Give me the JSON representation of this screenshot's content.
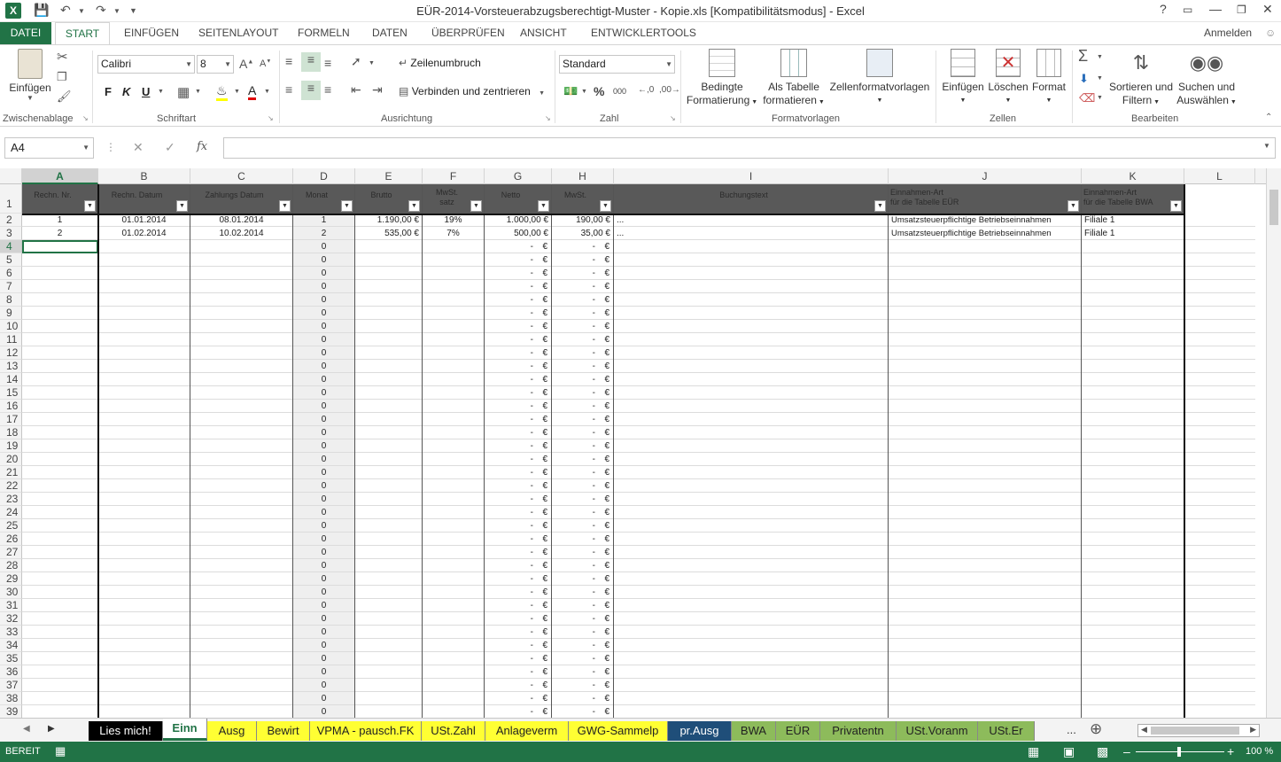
{
  "window": {
    "title": "EÜR-2014-Vorsteuerabzugsberechtigt-Muster - Kopie.xls  [Kompatibilitätsmodus] - Excel",
    "help": "?",
    "signin": "Anmelden"
  },
  "ribbon_tabs": [
    "DATEI",
    "START",
    "EINFÜGEN",
    "SEITENLAYOUT",
    "FORMELN",
    "DATEN",
    "ÜBERPRÜFEN",
    "ANSICHT",
    "ENTWICKLERTOOLS"
  ],
  "ribbon": {
    "clipboard": {
      "paste": "Einfügen",
      "label": "Zwischenablage"
    },
    "font": {
      "name": "Calibri",
      "size": "8",
      "bold": "F",
      "italic": "K",
      "underline": "U",
      "label": "Schriftart"
    },
    "alignment": {
      "wrap": "Zeilenumbruch",
      "merge": "Verbinden und zentrieren",
      "label": "Ausrichtung"
    },
    "number": {
      "format": "Standard",
      "percent": "%",
      "thousands": "000",
      "label": "Zahl"
    },
    "styles": {
      "conditional_1": "Bedingte",
      "conditional_2": "Formatierung",
      "table_1": "Als Tabelle",
      "table_2": "formatieren",
      "cellstyles": "Zellenformatvorlagen",
      "label": "Formatvorlagen"
    },
    "cells": {
      "insert": "Einfügen",
      "delete": "Löschen",
      "format": "Format",
      "label": "Zellen"
    },
    "editing": {
      "sort_1": "Sortieren und",
      "sort_2": "Filtern",
      "find_1": "Suchen und",
      "find_2": "Auswählen",
      "label": "Bearbeiten"
    }
  },
  "formula_bar": {
    "name_box": "A4",
    "fx": "fx",
    "value": ""
  },
  "columns": [
    "A",
    "B",
    "C",
    "D",
    "E",
    "F",
    "G",
    "H",
    "I",
    "J",
    "K",
    "L"
  ],
  "header_cells": [
    {
      "lines": [
        "Rechn. Nr."
      ]
    },
    {
      "lines": [
        "Rechn. Datum"
      ]
    },
    {
      "lines": [
        "Zahlungs Datum"
      ]
    },
    {
      "lines": [
        "Monat"
      ]
    },
    {
      "lines": [
        "Brutto"
      ]
    },
    {
      "lines": [
        "MwSt.",
        "satz"
      ]
    },
    {
      "lines": [
        "Netto"
      ]
    },
    {
      "lines": [
        "MwSt."
      ]
    },
    {
      "lines": [
        "Buchungstext"
      ]
    },
    {
      "lines": [
        "Einnahmen-Art",
        "für die Tabelle EÜR"
      ]
    },
    {
      "lines": [
        "Einnahmen-Art",
        "für die Tabelle BWA"
      ]
    }
  ],
  "data_rows": [
    {
      "row": "2",
      "a": "1",
      "b": "01.01.2014",
      "c": "08.01.2014",
      "d": "1",
      "e": "1.190,00 €",
      "f": "19%",
      "g": "1.000,00 €",
      "h": "190,00 €",
      "i": "...",
      "j": "Umsatzsteuerpflichtige Betriebseinnahmen",
      "k": "Filiale 1"
    },
    {
      "row": "3",
      "a": "2",
      "b": "01.02.2014",
      "c": "10.02.2014",
      "d": "2",
      "e": "535,00 €",
      "f": "7%",
      "g": "500,00 €",
      "h": "35,00 €",
      "i": "...",
      "j": "Umsatzsteuerpflichtige Betriebseinnahmen",
      "k": "Filiale 1"
    }
  ],
  "empty_row_values": {
    "d": "0",
    "g": "-",
    "currency": "€",
    "h": "-"
  },
  "row_numbers": [
    "1",
    "2",
    "3",
    "4",
    "5",
    "6",
    "7",
    "8",
    "9",
    "10",
    "11",
    "12",
    "13",
    "14",
    "15",
    "16",
    "17",
    "18",
    "19",
    "20",
    "21",
    "22",
    "23",
    "24",
    "25",
    "26",
    "27",
    "28",
    "29",
    "30",
    "31",
    "32",
    "33",
    "34",
    "35",
    "36",
    "37",
    "38",
    "39"
  ],
  "sheet_tabs": [
    {
      "name": "Lies mich!",
      "bg": "#000000",
      "fg": "#ffffff"
    },
    {
      "name": "Einn",
      "bg": "#ffffff",
      "fg": "#217346",
      "active": true
    },
    {
      "name": "Ausg",
      "bg": "#ffff33",
      "fg": "#222222"
    },
    {
      "name": "Bewirt",
      "bg": "#ffff33",
      "fg": "#222222"
    },
    {
      "name": "VPMA - pausch.FK",
      "bg": "#ffff33",
      "fg": "#222222"
    },
    {
      "name": "USt.Zahl",
      "bg": "#ffff33",
      "fg": "#222222"
    },
    {
      "name": "Anlageverm",
      "bg": "#ffff33",
      "fg": "#222222"
    },
    {
      "name": "GWG-Sammelp",
      "bg": "#ffff33",
      "fg": "#222222"
    },
    {
      "name": "pr.Ausg",
      "bg": "#1f4e79",
      "fg": "#ffffff"
    },
    {
      "name": "BWA",
      "bg": "#8dbb5b",
      "fg": "#222222"
    },
    {
      "name": "EÜR",
      "bg": "#8dbb5b",
      "fg": "#222222"
    },
    {
      "name": "Privatentn",
      "bg": "#8dbb5b",
      "fg": "#222222"
    },
    {
      "name": "USt.Voranm",
      "bg": "#8dbb5b",
      "fg": "#222222"
    },
    {
      "name": "USt.Er",
      "bg": "#8dbb5b",
      "fg": "#222222"
    }
  ],
  "sheet_more": "...",
  "status": {
    "mode": "BEREIT",
    "zoom": "100 %"
  },
  "colors": {
    "accent": "#217346",
    "header_fill": "#595959"
  }
}
